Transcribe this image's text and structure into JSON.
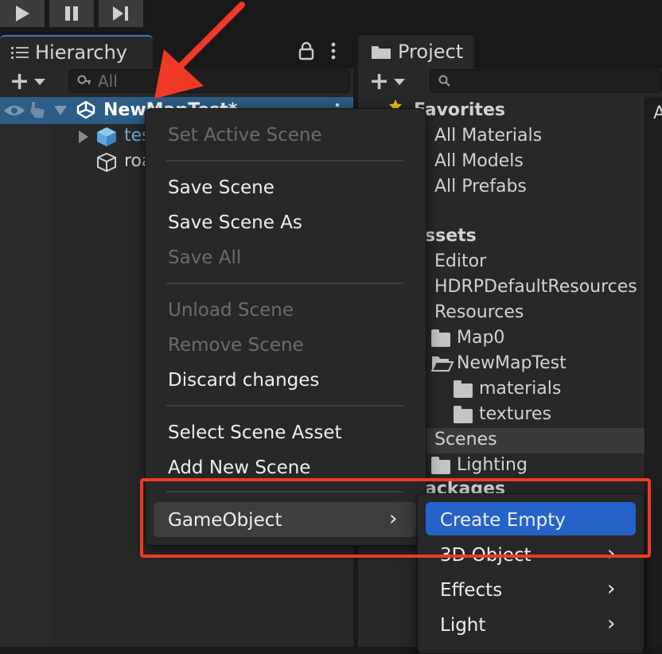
{
  "toolbar": {
    "play_icon": "play-icon",
    "pause_icon": "pause-icon",
    "step_icon": "step-icon"
  },
  "hierarchy": {
    "tab_label": "Hierarchy",
    "search_placeholder": "All",
    "scene_name": "NewMapTest*",
    "children": [
      {
        "label": "tes"
      },
      {
        "label": "roa"
      }
    ]
  },
  "project": {
    "tab_label": "Project",
    "right_panel_letter": "A",
    "favorites_header": "Favorites",
    "favorites": [
      "All Materials",
      "All Models",
      "All Prefabs"
    ],
    "assets_header": "ssets",
    "assets": [
      "Editor",
      "HDRPDefaultResources",
      "Resources",
      "Map0",
      "NewMapTest",
      "materials",
      "textures",
      "Scenes",
      "Lighting"
    ],
    "packages_header": "ackages"
  },
  "context_menu": {
    "items": [
      {
        "label": "Set Active Scene",
        "enabled": false
      },
      {
        "label": "Save Scene",
        "enabled": true
      },
      {
        "label": "Save Scene As",
        "enabled": true
      },
      {
        "label": "Save All",
        "enabled": false
      },
      {
        "label": "Unload Scene",
        "enabled": false
      },
      {
        "label": "Remove Scene",
        "enabled": false
      },
      {
        "label": "Discard changes",
        "enabled": true
      },
      {
        "label": "Select Scene Asset",
        "enabled": true
      },
      {
        "label": "Add New Scene",
        "enabled": true
      },
      {
        "label": "GameObject",
        "enabled": true
      }
    ],
    "submenu_chevron": "›"
  },
  "submenu": {
    "items": [
      {
        "label": "Create Empty"
      },
      {
        "label": "3D Object"
      },
      {
        "label": "Effects"
      },
      {
        "label": "Light"
      }
    ]
  },
  "colors": {
    "selection_blue": "#2563c9",
    "annotation_red": "#f03a25",
    "scene_row_blue": "#2c5d87"
  }
}
